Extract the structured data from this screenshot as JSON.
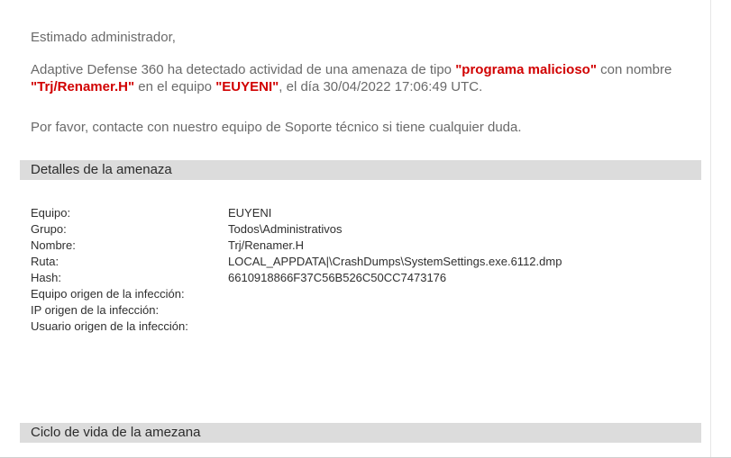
{
  "email": {
    "greeting": "Estimado administrador,",
    "alert": {
      "prefix": "Adaptive Defense 360 ha detectado actividad de una amenaza de tipo ",
      "threat_type": "\"programa malicioso\"",
      "middle": " con nombre ",
      "threat_name": "\"Trj/Renamer.H\"",
      "device_prefix": " en el equipo ",
      "device_name": "\"EUYENI\"",
      "suffix": ", el día 30/04/2022 17:06:49 UTC."
    },
    "support": "Por favor, contacte con nuestro equipo de Soporte técnico si tiene cualquier duda."
  },
  "sections": {
    "threat_details": {
      "header": "Detalles de la amenaza",
      "rows": [
        {
          "label": "Equipo:",
          "value": "EUYENI"
        },
        {
          "label": "Grupo:",
          "value": "Todos\\Administrativos"
        },
        {
          "label": "Nombre:",
          "value": "Trj/Renamer.H"
        },
        {
          "label": "Ruta:",
          "value": "LOCAL_APPDATA|\\CrashDumps\\SystemSettings.exe.6112.dmp"
        },
        {
          "label": "Hash:",
          "value": "6610918866F37C56B526C50CC7473176"
        },
        {
          "label": "Equipo origen de la infección:",
          "value": ""
        },
        {
          "label": "IP origen de la infección:",
          "value": ""
        },
        {
          "label": "Usuario origen de la infección:",
          "value": ""
        }
      ]
    },
    "lifecycle": {
      "header": "Ciclo de vida de la amezana"
    }
  }
}
